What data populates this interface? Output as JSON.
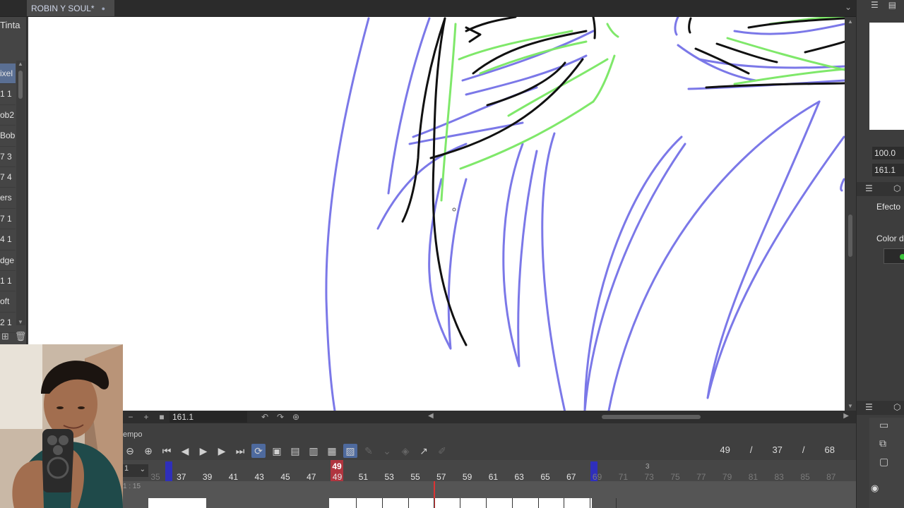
{
  "document_tab": {
    "title": "ROBIN Y SOUL*",
    "modified_marker": "●"
  },
  "left_panel": {
    "header": "Tinta",
    "items": [
      "ixel",
      "1 1",
      "ob2",
      "Bob",
      "7 3",
      "7 4",
      "ers",
      "7 1",
      "4 1",
      "dge",
      "1 1",
      "oft",
      "2 1"
    ],
    "selected_index": 0
  },
  "status_bar": {
    "zoom": "161.1"
  },
  "timeline": {
    "panel_title": "empo",
    "current_frame": "49",
    "start_frame": "37",
    "end_frame": "68",
    "separator": "/",
    "ruler_ticks": [
      "35",
      "37",
      "39",
      "41",
      "43",
      "45",
      "47",
      "49",
      "51",
      "53",
      "55",
      "57",
      "59",
      "61",
      "63",
      "65",
      "67",
      "69",
      "71",
      "73",
      "75",
      "77",
      "79",
      "81",
      "83",
      "85",
      "87"
    ],
    "faded_ticks": [
      "35",
      "69",
      "71",
      "73",
      "75",
      "77",
      "79",
      "81",
      "83",
      "85",
      "87"
    ],
    "playhead_label": "49",
    "small_marker": "3",
    "layer_selector": "1",
    "track_label": "1 : 15"
  },
  "right_panel": {
    "zoom_field": "100.0",
    "angle_field": "161.1",
    "section_effects": "Efecto",
    "section_color": "Color d",
    "accent_green": "#3cc43c"
  },
  "colors": {
    "sketch_blue": "#7b78e8",
    "sketch_green": "#7fe86a",
    "ink_black": "#111111",
    "playhead_red": "#b0353f",
    "range_marker_blue": "#2c2cc8",
    "selected_item_blue": "#5a6f93"
  }
}
